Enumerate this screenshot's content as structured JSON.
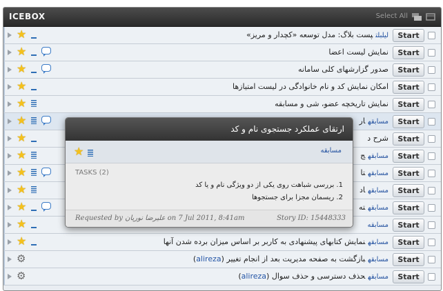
{
  "panel": {
    "title": "ICEBOX",
    "select_all": "Select All"
  },
  "rows": [
    {
      "label": "ليلبلت",
      "text": "پست بلاگ: مدل توسعه «کچدار و مریز»",
      "star": true,
      "icon": "dash",
      "comment": false,
      "start": "Start"
    },
    {
      "label": "",
      "text": "نمایش لیست اعضا",
      "star": true,
      "icon": "dash",
      "comment": true,
      "start": "Start"
    },
    {
      "label": "",
      "text": "صدور گزارشهای کلی سامانه",
      "star": true,
      "icon": "dash",
      "comment": true,
      "start": "Start"
    },
    {
      "label": "",
      "text": "امکان نمایش کد و نام خانوادگی در لیست امتیازها",
      "star": true,
      "icon": "dash",
      "comment": false,
      "start": "Start"
    },
    {
      "label": "",
      "text": "نمایش تاریخچه عضو، شی و مسابقه",
      "star": true,
      "icon": "lines",
      "comment": false,
      "start": "Start"
    },
    {
      "label": "مسابقه",
      "text": "ار",
      "star": true,
      "icon": "lines",
      "comment": true,
      "start": "Start"
    },
    {
      "label": "",
      "text": "شرح د",
      "star": true,
      "icon": "dash",
      "comment": false,
      "start": "Start"
    },
    {
      "label": "مسابقه",
      "text": "ج",
      "star": true,
      "icon": "lines",
      "comment": false,
      "start": "Start"
    },
    {
      "label": "مسابقه",
      "text": "تا",
      "star": true,
      "icon": "lines",
      "comment": true,
      "start": "Start"
    },
    {
      "label": "مسابقه",
      "text": "اد",
      "star": true,
      "icon": "lines",
      "comment": false,
      "start": "Start"
    },
    {
      "label": "مسابقه",
      "text": "ته",
      "star": true,
      "icon": "dash",
      "comment": true,
      "start": "Start"
    },
    {
      "label": "مسابقه",
      "text": "",
      "star": true,
      "icon": "dash",
      "comment": false,
      "start": "Start"
    },
    {
      "label": "مسابقه",
      "text": "نمایش کتابهای پیشنهادی به کاربر بر اساس میزان برده شدن آنها",
      "star": true,
      "icon": "dash",
      "comment": false,
      "start": "Start"
    },
    {
      "label": "مسابقه",
      "text": "بازگشت به صفحه مدیریت بعد از انجام تغییر",
      "owner": "alireza",
      "star": false,
      "gear": true,
      "start": "Start"
    },
    {
      "label": "مسابقه",
      "text": "حذف دسترسی و حذف سوال",
      "owner": "alireza",
      "star": false,
      "gear": true,
      "start": "Start"
    }
  ],
  "popup": {
    "title": "ارتقای عملکرد جستجوی نام و کد",
    "label": "مسابقه",
    "tasks_header": "TASKS (2)",
    "task1": "1. بررسی شباهت روی یکی از دو ویژگی نام و یا کد",
    "task2": "2. ریسمان مجزا برای جستجوها",
    "requested": "Requested by علیرضا نوریان on 7 Jul 2011, 8:41am",
    "story_id": "Story ID: 15448333"
  }
}
